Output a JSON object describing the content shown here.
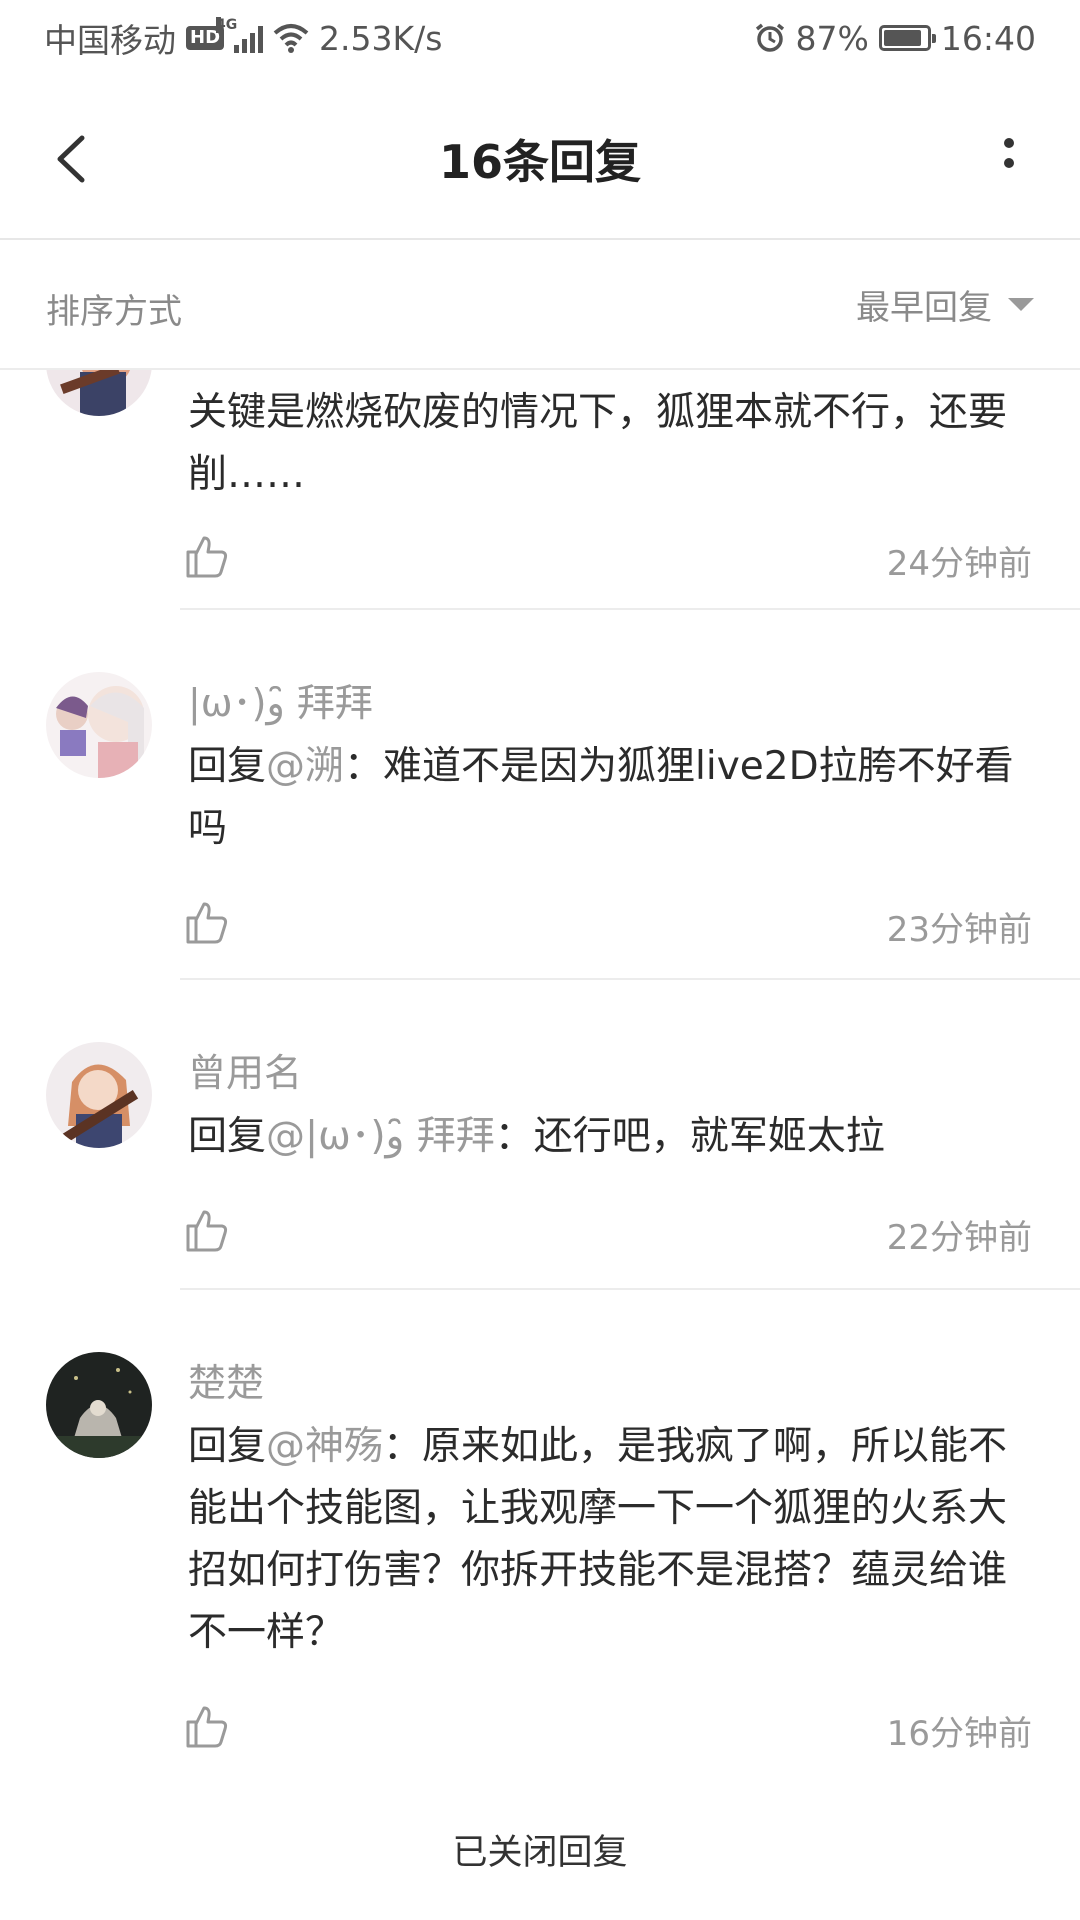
{
  "status_bar": {
    "carrier": "中国移动",
    "hd": "HD",
    "network": "4G",
    "speed": "2.53K/s",
    "battery": "87%",
    "battery_level": 0.87,
    "time": "16:40"
  },
  "header": {
    "title": "16条回复"
  },
  "sort": {
    "label": "排序方式",
    "selected": "最早回复"
  },
  "comments": [
    {
      "user": "",
      "text": "关键是燃烧砍废的情况下，狐狸本就不行，还要削……",
      "time": "24分钟前"
    },
    {
      "user": "|ω･)و ̑̑拜拜",
      "reply_prefix": "回复",
      "mention": "@溯",
      "text": "：难道不是因为狐狸live2D拉胯不好看吗",
      "time": "23分钟前"
    },
    {
      "user": "曾用名",
      "reply_prefix": "回复",
      "mention": "@|ω･)و ̑̑拜拜",
      "text": "：还行吧，就军姬太拉",
      "time": "22分钟前"
    },
    {
      "user": "楚楚",
      "reply_prefix": "回复",
      "mention": "@神殇",
      "text": "：原来如此，是我疯了啊，所以能不能出个技能图，让我观摩一下一个狐狸的火系大招如何打伤害？你拆开技能不是混搭？蕴灵给谁不一样？",
      "time": "16分钟前"
    }
  ],
  "footer": {
    "closed_text": "已关闭回复"
  },
  "colors": {
    "muted": "#9a9a9a",
    "text": "#2b2b2b",
    "divider": "#ececec"
  }
}
